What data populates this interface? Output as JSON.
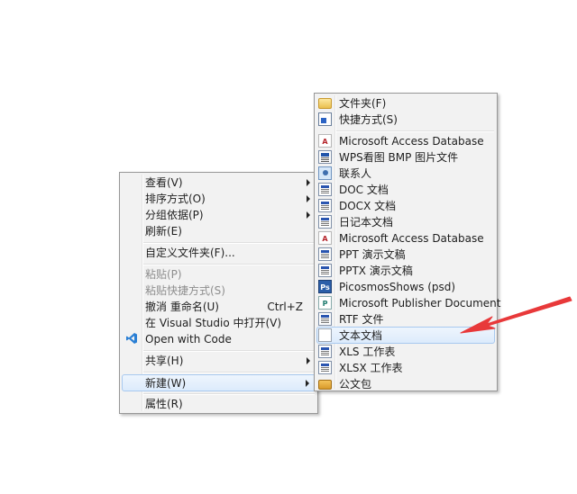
{
  "context_menu": {
    "items": [
      {
        "label": "查看(V)",
        "submenu": true
      },
      {
        "label": "排序方式(O)",
        "submenu": true
      },
      {
        "label": "分组依据(P)",
        "submenu": true
      },
      {
        "label": "刷新(E)"
      },
      {
        "label": "自定义文件夹(F)..."
      },
      {
        "label": "粘贴(P)",
        "disabled": true
      },
      {
        "label": "粘贴快捷方式(S)",
        "disabled": true
      },
      {
        "label": "撤消 重命名(U)",
        "shortcut": "Ctrl+Z"
      },
      {
        "label": "在 Visual Studio 中打开(V)"
      },
      {
        "label": "Open with Code",
        "icon": "vscode-icon"
      },
      {
        "label": "共享(H)",
        "submenu": true
      },
      {
        "label": "新建(W)",
        "submenu": true,
        "highlighted": true
      },
      {
        "label": "属性(R)"
      }
    ]
  },
  "new_submenu": {
    "items": [
      {
        "label": "文件夹(F)",
        "icon": "folder-icon"
      },
      {
        "label": "快捷方式(S)",
        "icon": "shortcut-icon"
      },
      {
        "label": "Microsoft Access Database",
        "icon": "access-icon"
      },
      {
        "label": "WPS看图 BMP 图片文件",
        "icon": "wps-image-icon"
      },
      {
        "label": "联系人",
        "icon": "contact-icon"
      },
      {
        "label": "DOC 文档",
        "icon": "doc-icon"
      },
      {
        "label": "DOCX 文档",
        "icon": "docx-icon"
      },
      {
        "label": "日记本文档",
        "icon": "journal-icon"
      },
      {
        "label": "Microsoft Access Database",
        "icon": "access-icon"
      },
      {
        "label": "PPT 演示文稿",
        "icon": "ppt-icon"
      },
      {
        "label": "PPTX 演示文稿",
        "icon": "pptx-icon"
      },
      {
        "label": "PicosmosShows (psd)",
        "icon": "picosmos-icon"
      },
      {
        "label": "Microsoft Publisher Document",
        "icon": "publisher-icon"
      },
      {
        "label": "RTF 文件",
        "icon": "rtf-icon"
      },
      {
        "label": "文本文档",
        "icon": "text-document-icon",
        "highlighted": true
      },
      {
        "label": "XLS 工作表",
        "icon": "xls-icon"
      },
      {
        "label": "XLSX 工作表",
        "icon": "xlsx-icon"
      },
      {
        "label": "公文包",
        "icon": "briefcase-icon"
      }
    ]
  },
  "annotation": {
    "arrow_color": "#e8393a"
  }
}
